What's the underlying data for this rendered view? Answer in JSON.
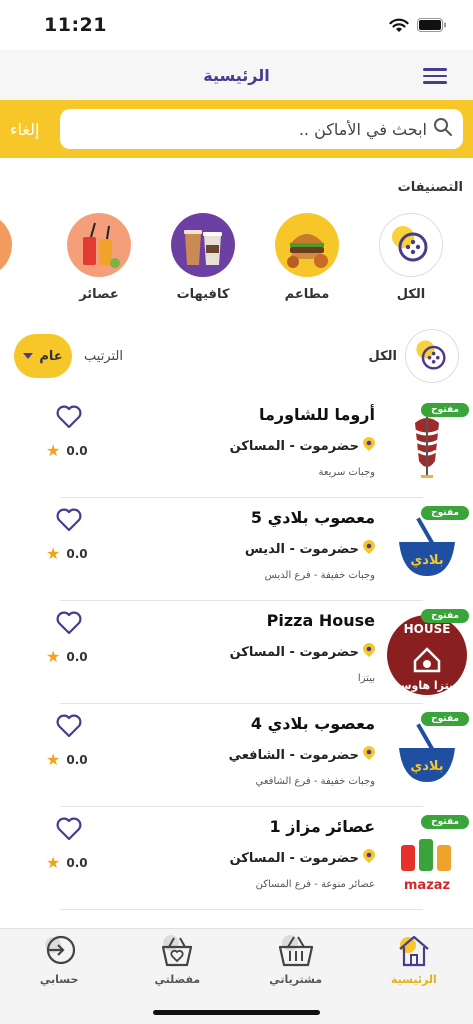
{
  "status": {
    "time": "11:21"
  },
  "nav": {
    "title": "الرئيسية"
  },
  "search": {
    "placeholder": "ابحث في الأماكن ..",
    "cancel": "إلغاء"
  },
  "categories_title": "التصنيفات",
  "categories": [
    {
      "label": "الكل",
      "icon": "dots-circle-icon"
    },
    {
      "label": "مطاعم",
      "icon": "burger-icon"
    },
    {
      "label": "كافيهات",
      "icon": "coffee-icon"
    },
    {
      "label": "عصائر",
      "icon": "juice-icon"
    }
  ],
  "filter": {
    "all_label": "الكل",
    "sort_label": "الترتيب",
    "sort_value": "عام"
  },
  "places": [
    {
      "name": "أروما للشاورما",
      "location": "حضرموت - المساكن",
      "description": "وجبات سريعة",
      "badge": "مفتوح",
      "rating": "0.0",
      "logo": "shawarma-logo"
    },
    {
      "name": "معصوب بلادي 5",
      "location": "حضرموت - الديس",
      "description": "وجبات خفيفة - فرع الديس",
      "badge": "مفتوح",
      "rating": "0.0",
      "logo": "baladi-logo"
    },
    {
      "name": "Pizza House",
      "location": "حضرموت - المساكن",
      "description": "بيتزا",
      "badge": "مفتوح",
      "rating": "0.0",
      "logo": "pizza-house-logo",
      "logo_text_top": "HOUSE",
      "logo_text_bottom": "بيتزا هاوس"
    },
    {
      "name": "معصوب بلادي 4",
      "location": "حضرموت - الشافعي",
      "description": "وجبات خفيفة - فرع الشافعي",
      "badge": "مفتوح",
      "rating": "0.0",
      "logo": "baladi-logo"
    },
    {
      "name": "عصائر مزاز 1",
      "location": "حضرموت - المساكن",
      "description": "عصائر منوعة - فرع المساكن",
      "badge": "مفتوح",
      "rating": "0.0",
      "logo": "mazaz-logo",
      "logo_text": "mazaz"
    }
  ],
  "tabs": [
    {
      "label": "الرئيسية",
      "icon": "home-icon",
      "active": true
    },
    {
      "label": "مشترياتي",
      "icon": "basket-icon",
      "active": false
    },
    {
      "label": "مفضلتي",
      "icon": "favorites-basket-icon",
      "active": false
    },
    {
      "label": "حسابي",
      "icon": "login-icon",
      "active": false
    }
  ],
  "colors": {
    "accent": "#f7c72a",
    "primary": "#4a3b8f",
    "open_badge": "#3aa33a",
    "star": "#f4a21b"
  }
}
